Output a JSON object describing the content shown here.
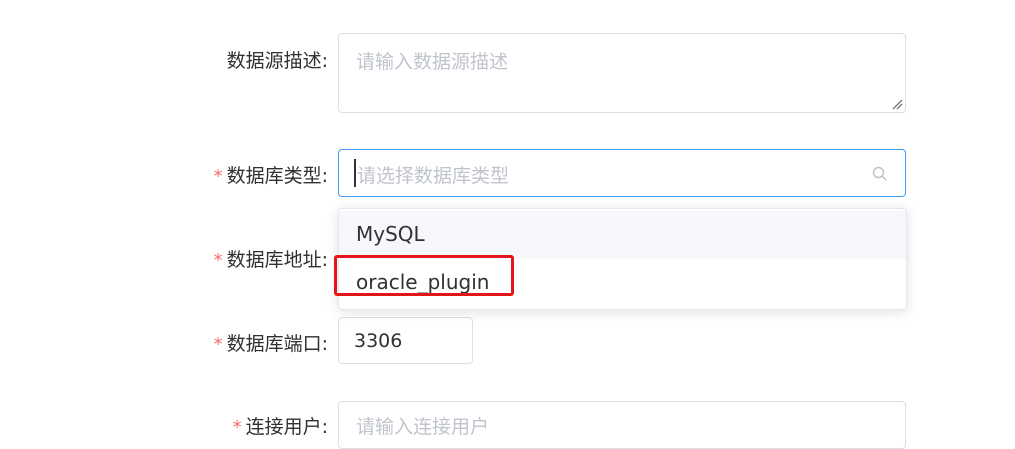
{
  "form": {
    "description": {
      "label": "数据源描述",
      "colon": ":",
      "placeholder": "请输入数据源描述"
    },
    "db_type": {
      "required_mark": "*",
      "label": "数据库类型",
      "colon": ":",
      "placeholder": "请选择数据库类型"
    },
    "db_address": {
      "required_mark": "*",
      "label": "数据库地址",
      "colon": ":"
    },
    "db_port": {
      "required_mark": "*",
      "label": "数据库端口",
      "colon": ":",
      "value": "3306"
    },
    "conn_user": {
      "required_mark": "*",
      "label": "连接用户",
      "colon": ":",
      "placeholder": "请输入连接用户"
    }
  },
  "dropdown": {
    "options": [
      {
        "label": "MySQL"
      },
      {
        "label": "oracle_plugin"
      }
    ]
  },
  "colors": {
    "required": "#f56c6c",
    "focus_border": "#409eff",
    "placeholder": "#c0c4cc",
    "hover_bg": "#f5f7fa",
    "annotation_box": "#e0161a"
  }
}
